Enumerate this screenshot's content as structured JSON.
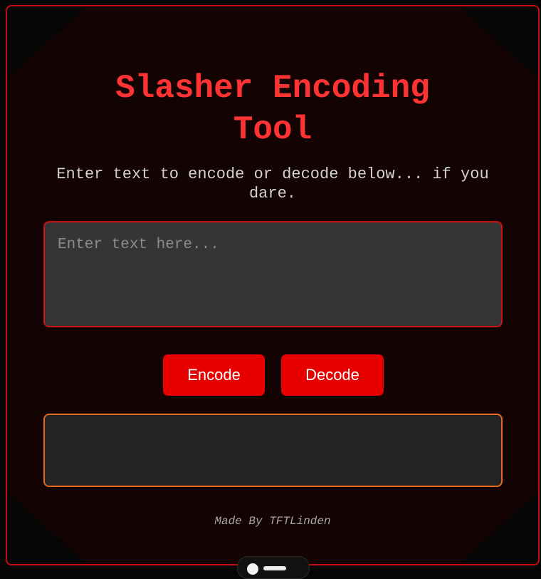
{
  "header": {
    "title_line1": "Slasher Encoding",
    "title_line2": "Tool",
    "subtitle": "Enter text to encode or decode below... if you dare."
  },
  "input": {
    "value": "",
    "placeholder": "Enter text here..."
  },
  "actions": {
    "encode_label": "Encode",
    "decode_label": "Decode"
  },
  "output": {
    "value": ""
  },
  "footer": {
    "credit": "Made By TFTLinden"
  },
  "colors": {
    "accent": "#e60000",
    "title": "#ff3333",
    "output_border": "#e8671f",
    "panel_background": "#140303"
  }
}
